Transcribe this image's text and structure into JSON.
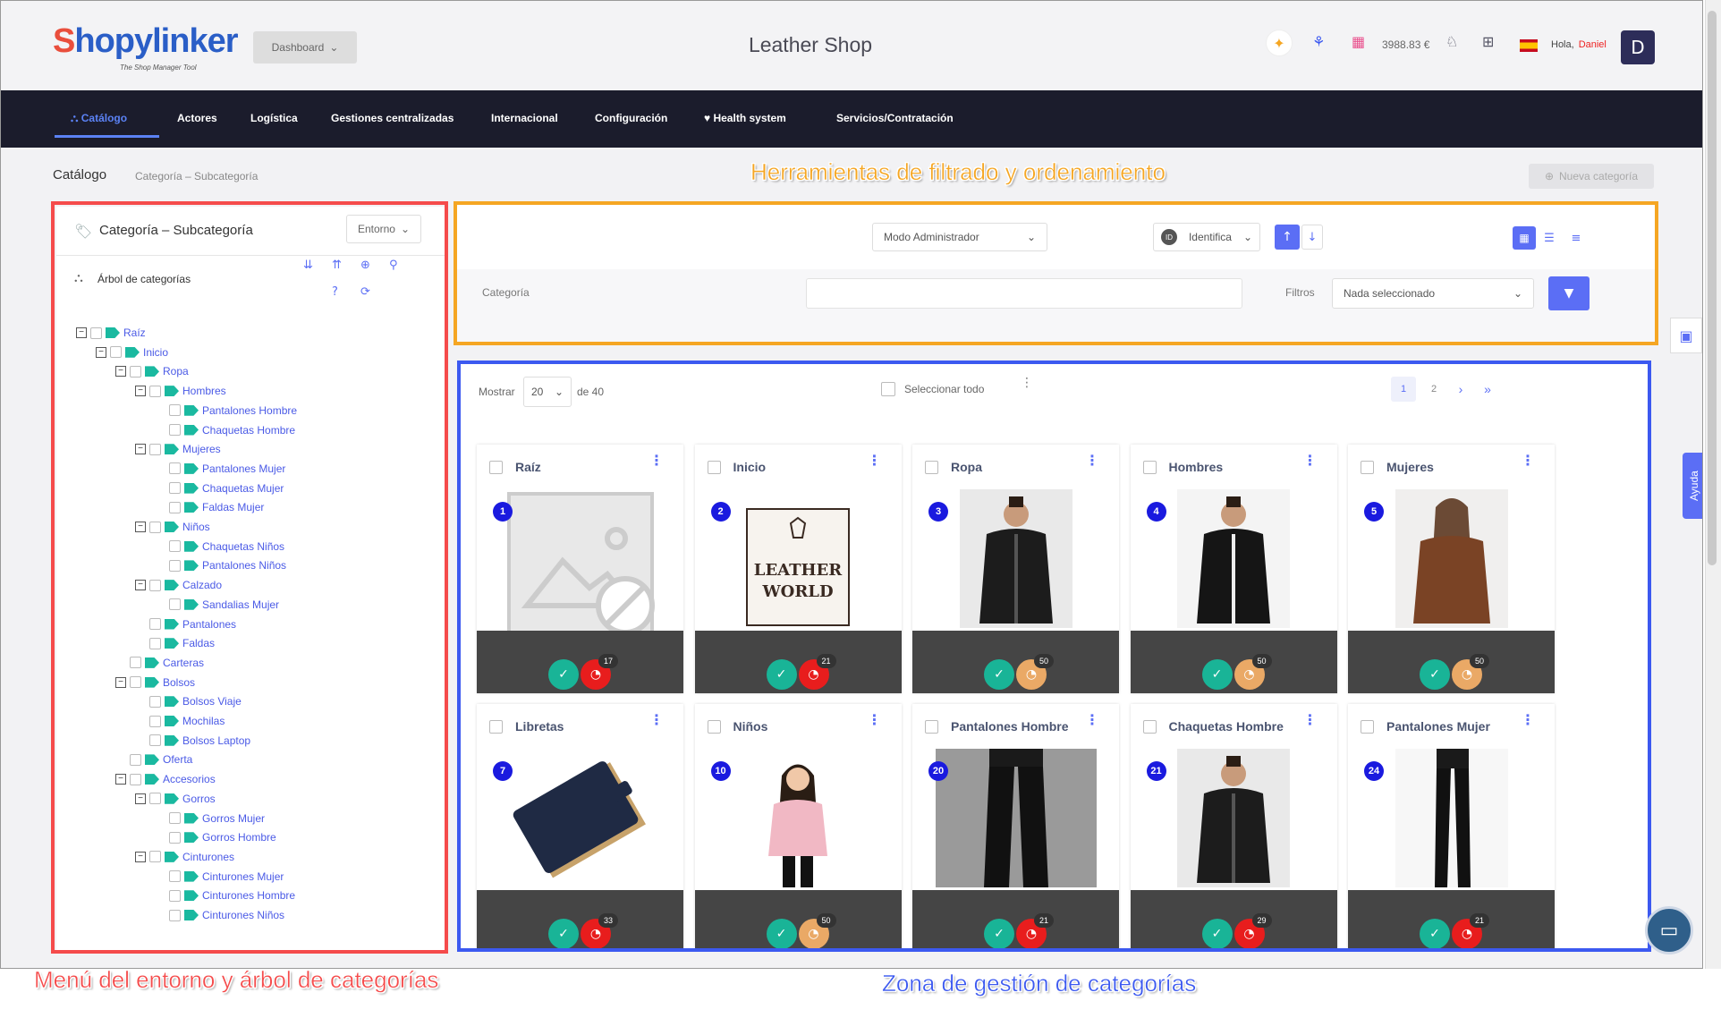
{
  "header": {
    "logo_main": "Shopylinker",
    "logo_sub": "The Shop Manager Tool",
    "dashboard_label": "Dashboard",
    "shop_title": "Leather Shop",
    "balance": "3988.83 €",
    "greeting": "Hola,",
    "user_name": "Daniel",
    "avatar_initial": "D"
  },
  "nav": {
    "items": [
      {
        "label": "Catálogo"
      },
      {
        "label": "Actores"
      },
      {
        "label": "Logística"
      },
      {
        "label": "Gestiones centralizadas"
      },
      {
        "label": "Internacional"
      },
      {
        "label": "Configuración"
      },
      {
        "label": "Health system"
      },
      {
        "label": "Servicios/Contratación"
      }
    ]
  },
  "breadcrumb": {
    "main": "Catálogo",
    "sub": "Categoría – Subcategoría"
  },
  "new_category_label": "Nueva categoría",
  "annotations": {
    "top": "Herramientas de filtrado y ordenamiento",
    "left": "Menú del entorno y árbol de categorías",
    "bottom": "Zona de gestión de categorías"
  },
  "colors": {
    "annotation_top": "#f5a623",
    "annotation_left": "#f54b4b",
    "annotation_bottom": "#3c59f0",
    "accent": "#5b6ef5"
  },
  "left_panel": {
    "title": "Categoría – Subcategoría",
    "env_select": "Entorno",
    "tree_label": "Árbol de categorías",
    "tree": [
      {
        "label": "Raíz",
        "level": 0,
        "toggle": "−"
      },
      {
        "label": "Inicio",
        "level": 1,
        "toggle": "−"
      },
      {
        "label": "Ropa",
        "level": 2,
        "toggle": "−"
      },
      {
        "label": "Hombres",
        "level": 3,
        "toggle": "−"
      },
      {
        "label": "Pantalones Hombre",
        "level": 4,
        "toggle": ""
      },
      {
        "label": "Chaquetas Hombre",
        "level": 4,
        "toggle": ""
      },
      {
        "label": "Mujeres",
        "level": 3,
        "toggle": "−"
      },
      {
        "label": "Pantalones Mujer",
        "level": 4,
        "toggle": ""
      },
      {
        "label": "Chaquetas Mujer",
        "level": 4,
        "toggle": ""
      },
      {
        "label": "Faldas Mujer",
        "level": 4,
        "toggle": ""
      },
      {
        "label": "Niños",
        "level": 3,
        "toggle": "−"
      },
      {
        "label": "Chaquetas Niños",
        "level": 4,
        "toggle": ""
      },
      {
        "label": "Pantalones Niños",
        "level": 4,
        "toggle": ""
      },
      {
        "label": "Calzado",
        "level": 3,
        "toggle": "−"
      },
      {
        "label": "Sandalias Mujer",
        "level": 4,
        "toggle": ""
      },
      {
        "label": "Pantalones",
        "level": 3,
        "toggle": ""
      },
      {
        "label": "Faldas",
        "level": 3,
        "toggle": ""
      },
      {
        "label": "Carteras",
        "level": 2,
        "toggle": ""
      },
      {
        "label": "Bolsos",
        "level": 2,
        "toggle": "−"
      },
      {
        "label": "Bolsos Viaje",
        "level": 3,
        "toggle": ""
      },
      {
        "label": "Mochilas",
        "level": 3,
        "toggle": ""
      },
      {
        "label": "Bolsos Laptop",
        "level": 3,
        "toggle": ""
      },
      {
        "label": "Oferta",
        "level": 2,
        "toggle": ""
      },
      {
        "label": "Accesorios",
        "level": 2,
        "toggle": "−"
      },
      {
        "label": "Gorros",
        "level": 3,
        "toggle": "−"
      },
      {
        "label": "Gorros Mujer",
        "level": 4,
        "toggle": ""
      },
      {
        "label": "Gorros Hombre",
        "level": 4,
        "toggle": ""
      },
      {
        "label": "Cinturones",
        "level": 3,
        "toggle": "−"
      },
      {
        "label": "Cinturones Mujer",
        "level": 4,
        "toggle": ""
      },
      {
        "label": "Cinturones Hombre",
        "level": 4,
        "toggle": ""
      },
      {
        "label": "Cinturones Niños",
        "level": 4,
        "toggle": ""
      }
    ]
  },
  "filters": {
    "mode_select": "Modo Administrador",
    "sort_select": "Identifica",
    "category_label": "Categoría",
    "category_value": "",
    "filters_label": "Filtros",
    "filters_select": "Nada seleccionado"
  },
  "grid": {
    "show_label": "Mostrar",
    "per_page": "20",
    "of_total": "de 40",
    "select_all": "Seleccionar todo",
    "pages": [
      "1",
      "2"
    ],
    "cards": [
      {
        "name": "Raíz",
        "id": "1",
        "count": "17",
        "status": "warn",
        "img": "placeholder"
      },
      {
        "name": "Inicio",
        "id": "2",
        "count": "21",
        "status": "warn",
        "img": "logo"
      },
      {
        "name": "Ropa",
        "id": "3",
        "count": "50",
        "status": "mid",
        "img": "man-jacket"
      },
      {
        "name": "Hombres",
        "id": "4",
        "count": "50",
        "status": "mid",
        "img": "man-jacket-white"
      },
      {
        "name": "Mujeres",
        "id": "5",
        "count": "50",
        "status": "mid",
        "img": "woman-brown"
      },
      {
        "name": "Libretas",
        "id": "7",
        "count": "33",
        "status": "warn",
        "img": "notebook"
      },
      {
        "name": "Niños",
        "id": "10",
        "count": "50",
        "status": "mid",
        "img": "girl"
      },
      {
        "name": "Pantalones Hombre",
        "id": "20",
        "count": "21",
        "status": "warn",
        "img": "leather-pants"
      },
      {
        "name": "Chaquetas Hombre",
        "id": "21",
        "count": "29",
        "status": "warn",
        "img": "man-jacket"
      },
      {
        "name": "Pantalones Mujer",
        "id": "24",
        "count": "21",
        "status": "warn",
        "img": "woman-pants"
      }
    ]
  },
  "help_label": "Ayuda"
}
